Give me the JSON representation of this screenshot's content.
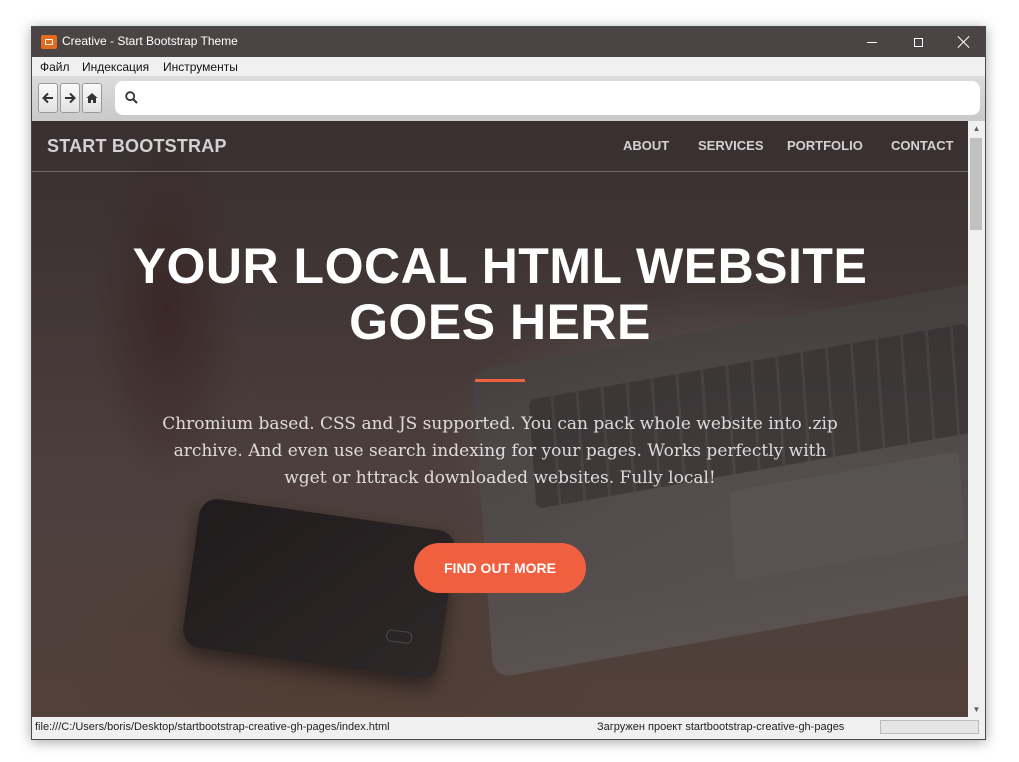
{
  "window": {
    "title": "Creative - Start Bootstrap Theme",
    "controls": {
      "minimize": "minimize",
      "maximize": "maximize",
      "close": "close"
    }
  },
  "menu": {
    "items": [
      "Файл",
      "Индексация",
      "Инструменты"
    ]
  },
  "toolbar": {
    "back_icon": "arrow-left-icon",
    "forward_icon": "arrow-right-icon",
    "home_icon": "home-icon",
    "search_icon": "search-icon",
    "search_value": ""
  },
  "page": {
    "brand": "START BOOTSTRAP",
    "nav": [
      "ABOUT",
      "SERVICES",
      "PORTFOLIO",
      "CONTACT"
    ],
    "hero_title_lines": [
      "YOUR LOCAL HTML WEBSITE",
      "GOES HERE"
    ],
    "hero_text": "Chromium based. CSS and JS supported. You can pack whole website into .zip archive. And even use search indexing for your pages. Works perfectly with wget or httrack downloaded websites. Fully local!",
    "cta": "FIND OUT MORE",
    "accent_color": "#f05f40"
  },
  "status": {
    "url": "file:///C:/Users/boris/Desktop/startbootstrap-creative-gh-pages/index.html",
    "message": "Загружен проект startbootstrap-creative-gh-pages"
  }
}
